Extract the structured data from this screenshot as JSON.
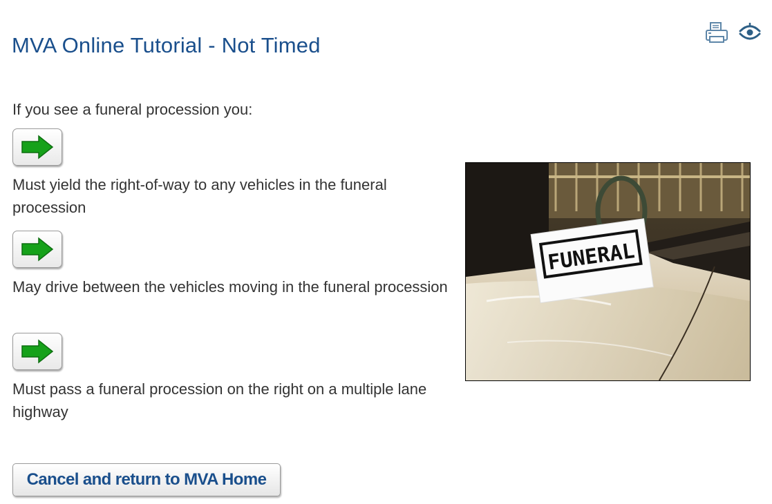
{
  "page": {
    "title": "MVA Online Tutorial - Not Timed"
  },
  "toolbar": {
    "icons": [
      "printer-icon",
      "visibility-icon"
    ]
  },
  "quiz": {
    "question": "If you see a funeral procession you:",
    "answers": [
      {
        "text": "Must yield the right-of-way to any vehicles in the funeral procession",
        "icon": "green-arrow-right-icon"
      },
      {
        "text": "May drive between the vehicles moving in the funeral procession",
        "icon": "green-arrow-right-icon"
      },
      {
        "text": "Must pass a funeral procession on the right on a multiple lane highway",
        "icon": "green-arrow-right-icon"
      }
    ],
    "image": {
      "sign_text": "FUNERAL"
    }
  },
  "footer": {
    "cancel_label": "Cancel and return to MVA Home"
  },
  "colors": {
    "title": "#1a4f8c",
    "body_text": "#333333",
    "arrow_green": "#16a11a",
    "button_text": "#1a4f8c"
  }
}
